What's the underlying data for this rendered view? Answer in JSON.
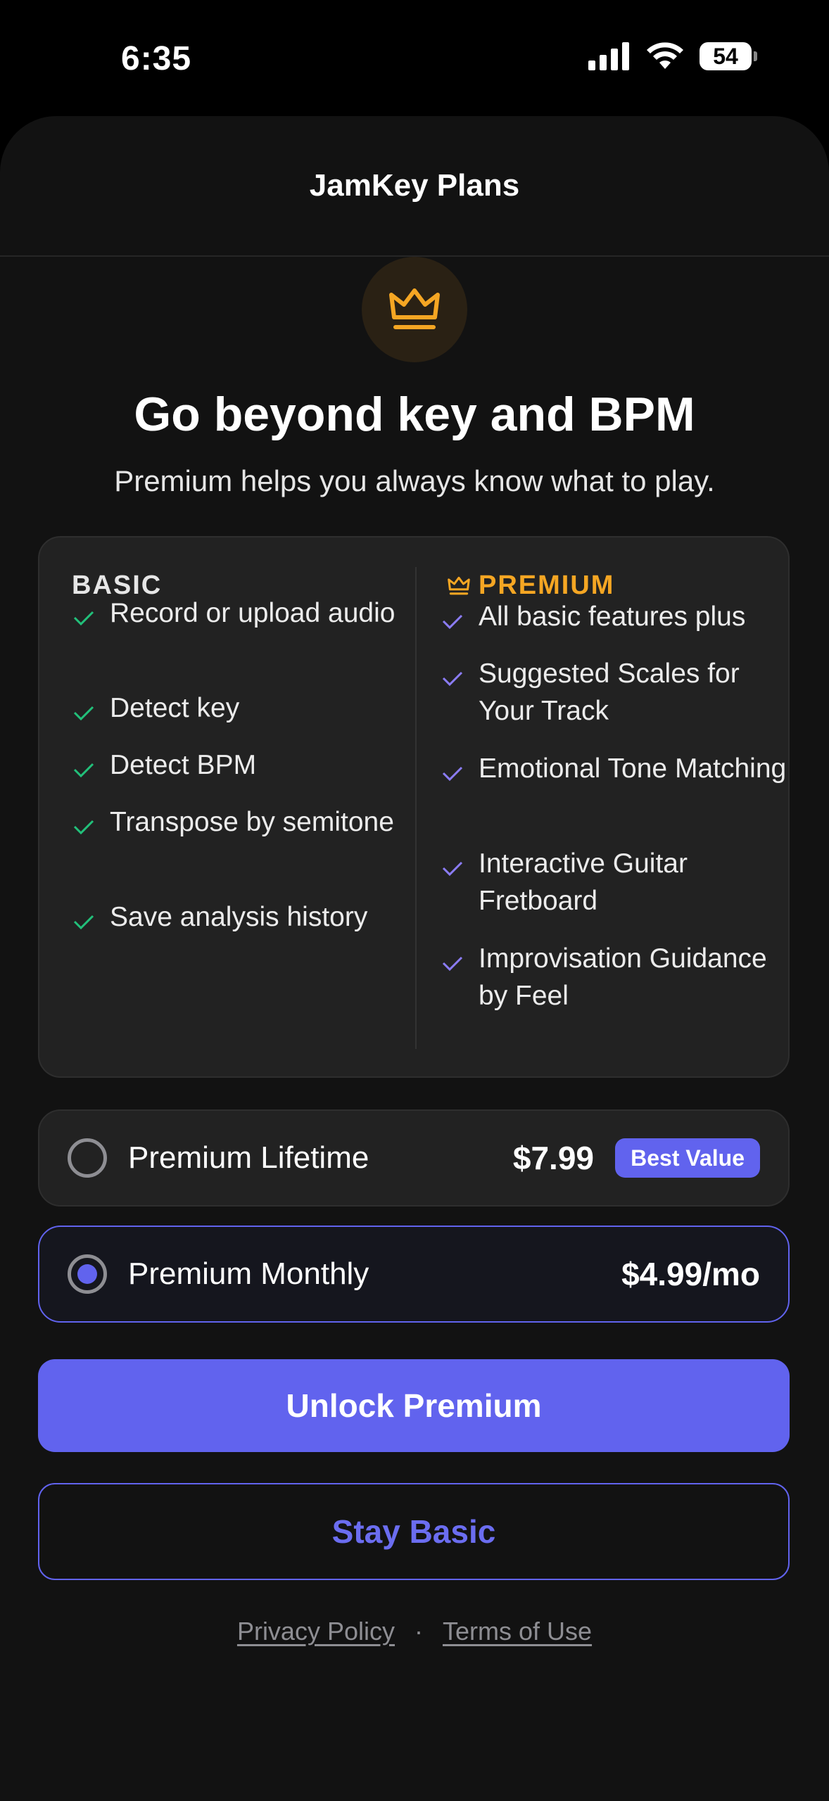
{
  "status_bar": {
    "time": "6:35",
    "battery": "54",
    "icons": [
      "cellular-signal-icon",
      "wifi-icon",
      "battery-icon"
    ]
  },
  "header": {
    "title": "JamKey Plans"
  },
  "hero": {
    "icon": "crown-icon",
    "headline": "Go beyond key and BPM",
    "subheadline": "Premium helps you always know what to play."
  },
  "comparison": {
    "basic": {
      "title": "BASIC",
      "features": [
        "Record or upload audio",
        "Detect key",
        "Detect BPM",
        "Transpose by semitone",
        "Save analysis history"
      ]
    },
    "premium": {
      "title": "PREMIUM",
      "features": [
        "All basic features plus",
        "Suggested Scales for Your Track",
        "Emotional Tone Matching",
        "Interactive Guitar Fretboard",
        "Improvisation Guidance by Feel"
      ]
    }
  },
  "plans": [
    {
      "name": "Premium Lifetime",
      "price": "$7.99",
      "badge": "Best Value",
      "selected": false
    },
    {
      "name": "Premium Monthly",
      "price": "$4.99/mo",
      "selected": true
    }
  ],
  "actions": {
    "primary_label": "Unlock Premium",
    "secondary_label": "Stay Basic"
  },
  "footer": {
    "privacy": "Privacy Policy",
    "separator": "·",
    "terms": "Terms of Use"
  },
  "colors": {
    "accent": "#6163ee",
    "premium_gold": "#f5a623",
    "basic_check": "#22c07a",
    "premium_check": "#8b7cf6",
    "background": "#121212",
    "card": "#222222"
  }
}
